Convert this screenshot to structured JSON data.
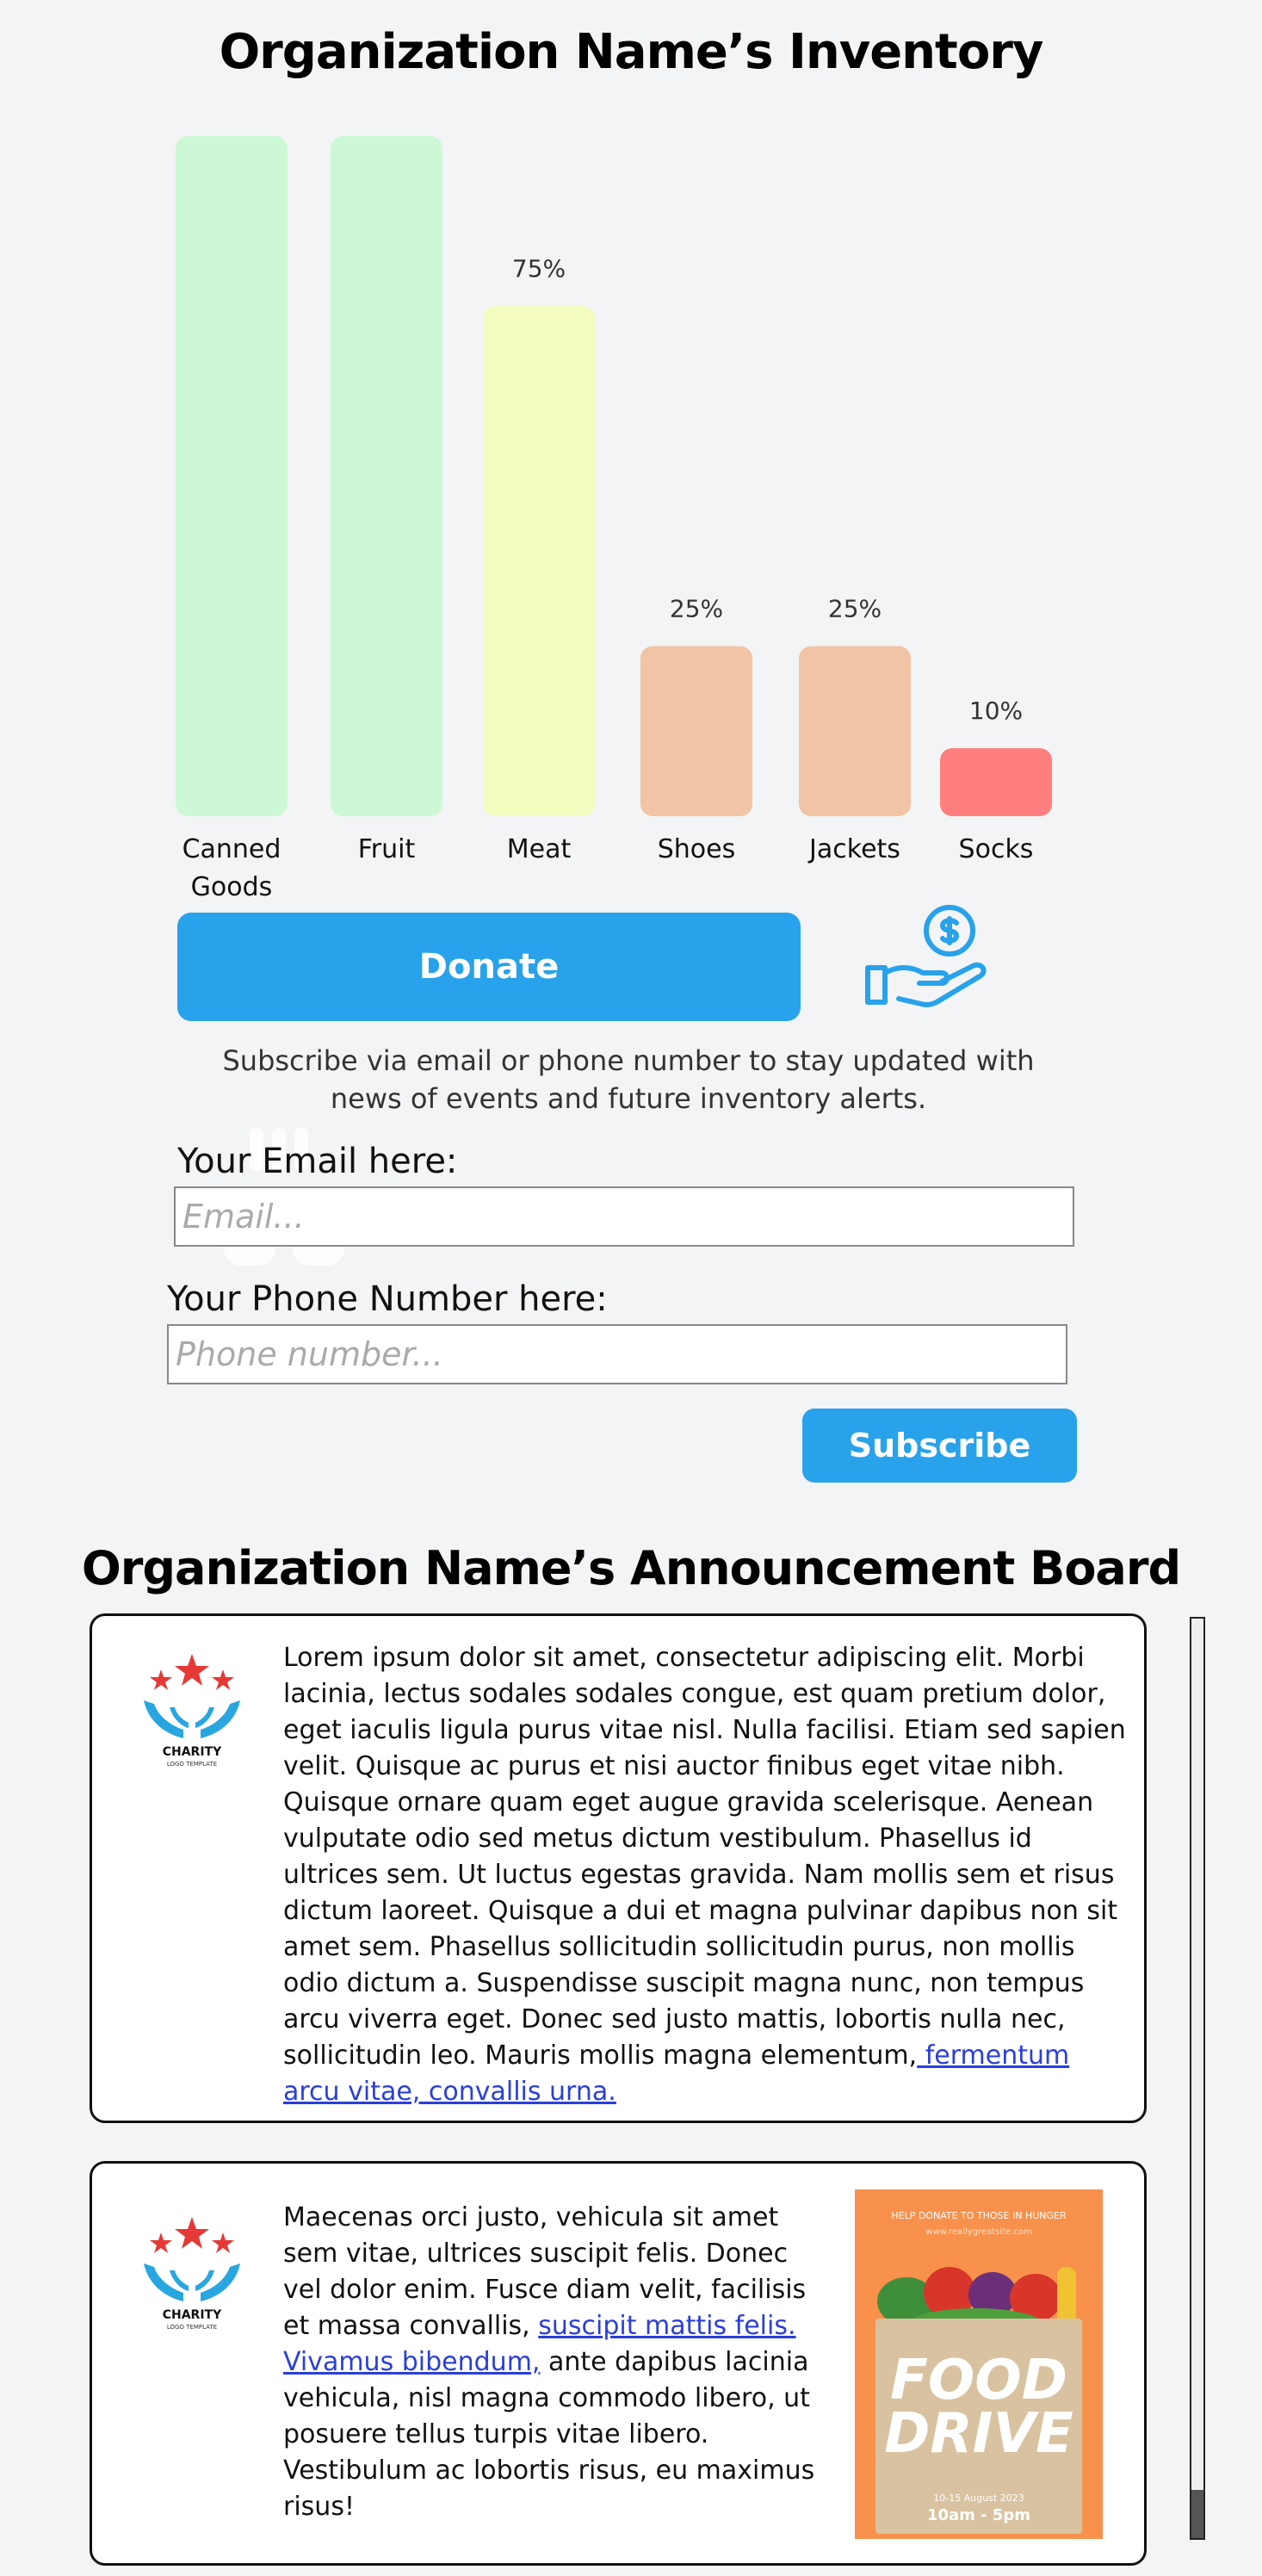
{
  "inventory": {
    "title": "Organization Name’s Inventory"
  },
  "chart_data": {
    "type": "bar",
    "categories": [
      "Canned Goods",
      "Fruit",
      "Meat",
      "Shoes",
      "Jackets",
      "Socks"
    ],
    "category_lines": [
      [
        "Canned",
        "Goods"
      ],
      [
        "Fruit"
      ],
      [
        "Meat"
      ],
      [
        "Shoes"
      ],
      [
        "Jackets"
      ],
      [
        "Socks"
      ]
    ],
    "values": [
      100,
      100,
      75,
      25,
      25,
      10
    ],
    "data_labels": [
      "",
      "",
      "75%",
      "25%",
      "25%",
      "10%"
    ],
    "colors": [
      "#cdf8d5",
      "#cdf8d5",
      "#f4fbbf",
      "#f0c4a4",
      "#f0c4a4",
      "#ff7e7e"
    ],
    "title": "",
    "xlabel": "",
    "ylabel": "",
    "ylim": [
      0,
      100
    ],
    "grid": false
  },
  "donate": {
    "label": "Donate",
    "icon": "hand-dollar-icon",
    "accent": "#28a2ea"
  },
  "subscribe": {
    "description": "Subscribe via email or phone number to stay updated with news of events and future inventory alerts.",
    "email_label": "Your Email here:",
    "email_placeholder": "Email...",
    "email_value": "",
    "phone_label": "Your Phone Number here:",
    "phone_placeholder": "Phone number...",
    "phone_value": "",
    "button_label": "Subscribe"
  },
  "announcements": {
    "title": "Organization Name’s Announcement Board",
    "posts": [
      {
        "logo_text": "CHARITY",
        "logo_subtext": "LOGO TEMPLATE",
        "body": "Lorem ipsum dolor sit amet, consectetur adipiscing elit. Morbi lacinia, lectus sodales sodales congue, est quam pretium dolor, eget iaculis ligula purus vitae nisl. Nulla facilisi. Etiam sed sapien velit. Quisque ac purus et nisi auctor finibus eget vitae nibh. Quisque ornare quam eget augue gravida scelerisque. Aenean vulputate odio sed metus dictum vestibulum. Phasellus id ultrices sem. Ut luctus egestas gravida. Nam mollis sem et risus dictum laoreet. Quisque a dui et magna pulvinar dapibus non sit amet sem. Phasellus sollicitudin sollicitudin purus, non mollis odio dictum a. Suspendisse suscipit magna nunc, non tempus arcu viverra eget. Donec sed justo mattis, lobortis nulla nec, sollicitudin leo. Mauris mollis magna elementum,",
        "link": " fermentum arcu vitae, convallis urna."
      },
      {
        "logo_text": "CHARITY",
        "logo_subtext": "LOGO TEMPLATE",
        "body_before": "Maecenas orci justo, vehicula sit amet sem vitae, ultrices suscipit felis. Donec vel dolor enim. Fusce diam velit, facilisis et massa convallis, ",
        "link": "suscipit mattis felis. Vivamus bibendum,",
        "body_after": " ante dapibus lacinia vehicula, nisl magna commodo libero, ut posuere tellus turpis vitae libero. Vestibulum ac lobortis risus, eu maximus risus!",
        "poster": {
          "top_text": "HELP DONATE TO THOSE IN HUNGER",
          "url": "www.reallygreatsite.com",
          "headline_1": "FOOD",
          "headline_2": "DRIVE",
          "date": "10-15 August 2023",
          "time": "10am - 5pm"
        }
      }
    ]
  }
}
